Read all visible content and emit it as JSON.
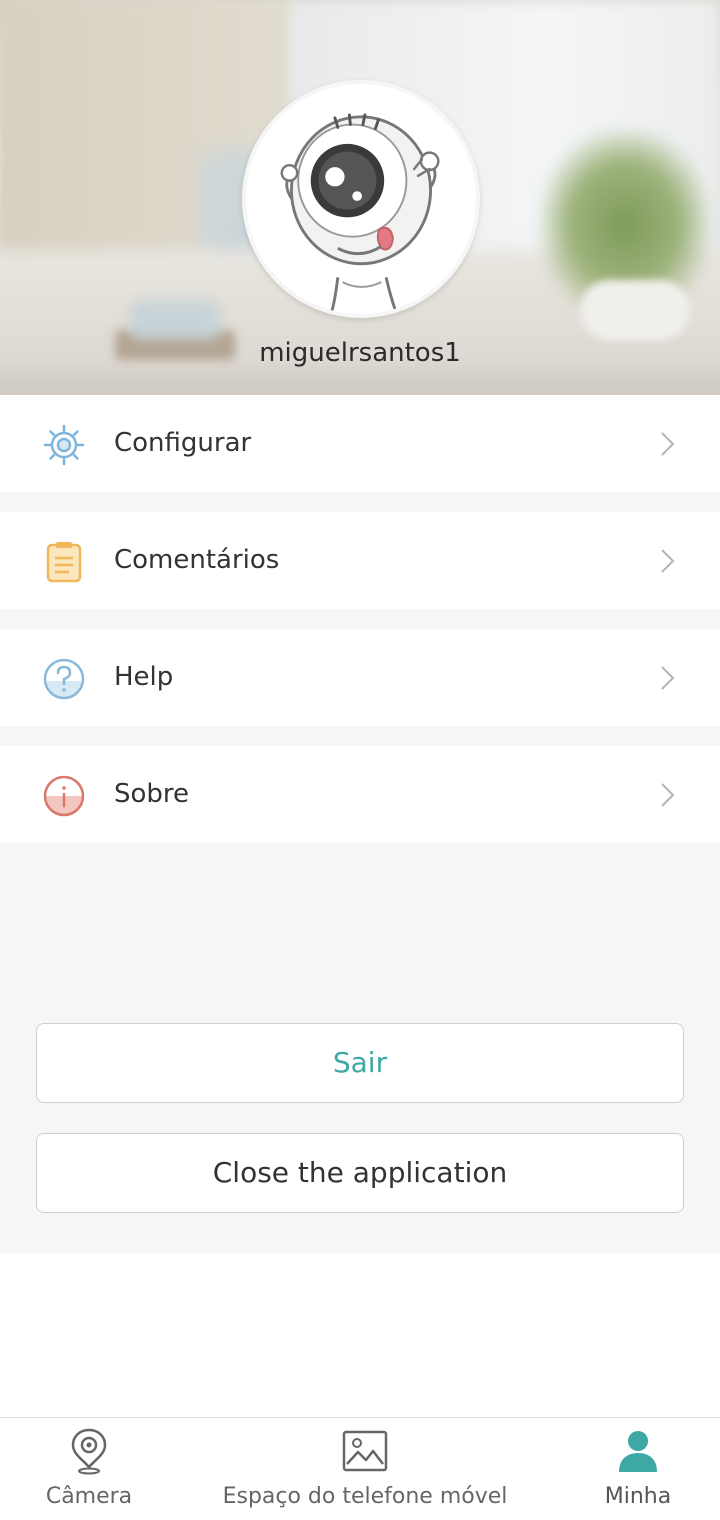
{
  "profile": {
    "username": "miguelrsantos1"
  },
  "menu": {
    "items": [
      {
        "label": "Configurar",
        "icon": "gear-icon"
      },
      {
        "label": "Comentários",
        "icon": "clipboard-icon"
      },
      {
        "label": "Help",
        "icon": "question-icon"
      },
      {
        "label": "Sobre",
        "icon": "info-icon"
      }
    ]
  },
  "actions": {
    "logout_label": "Sair",
    "close_label": "Close the application"
  },
  "tabbar": {
    "tabs": [
      {
        "label": "Câmera",
        "icon": "location-pin-icon"
      },
      {
        "label": "Espaço do telefone móvel",
        "icon": "image-icon"
      },
      {
        "label": "Minha",
        "icon": "person-icon",
        "active": true
      }
    ]
  },
  "colors": {
    "accent": "#3ea8a5",
    "gear": "#7fb5dc",
    "clipboard": "#f0b85a",
    "question": "#8ab8db",
    "info": "#d9786b"
  }
}
